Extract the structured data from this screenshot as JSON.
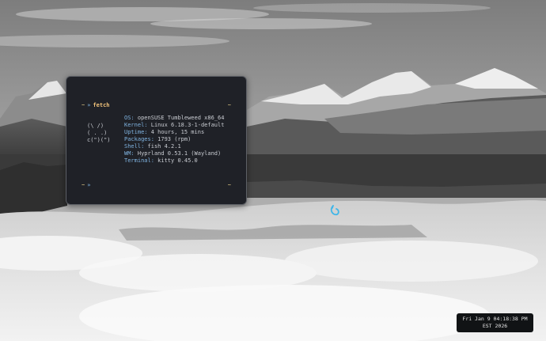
{
  "terminal": {
    "prompt1": {
      "tilde": "~",
      "arrow": "»",
      "command": "fetch",
      "right_tilde": "~"
    },
    "ascii_art": [
      "(\\ /)",
      "( . .)",
      "c(\")(\")"
    ],
    "info": [
      {
        "key": "OS:",
        "value": "openSUSE Tumbleweed x86_64"
      },
      {
        "key": "Kernel:",
        "value": "Linux 6.18.3-1-default"
      },
      {
        "key": "Uptime:",
        "value": "4 hours, 15 mins"
      },
      {
        "key": "Packages:",
        "value": "1793 (rpm)"
      },
      {
        "key": "Shell:",
        "value": "fish 4.2.1"
      },
      {
        "key": "WM:",
        "value": "Hyprland 0.53.1 (Wayland)"
      },
      {
        "key": "Terminal:",
        "value": "kitty 0.45.0"
      }
    ],
    "prompt2": {
      "tilde": "~",
      "arrow": "»",
      "right_tilde": "~"
    }
  },
  "clock": {
    "line1": "Fri Jan  9 04:18:38 PM",
    "line2": "EST 2026"
  },
  "colors": {
    "accent_blue": "#7fb3e0",
    "prompt_yellow": "#e8d08a",
    "terminal_bg": "#1f2127",
    "cursor_cyan": "#3fb6e8"
  }
}
